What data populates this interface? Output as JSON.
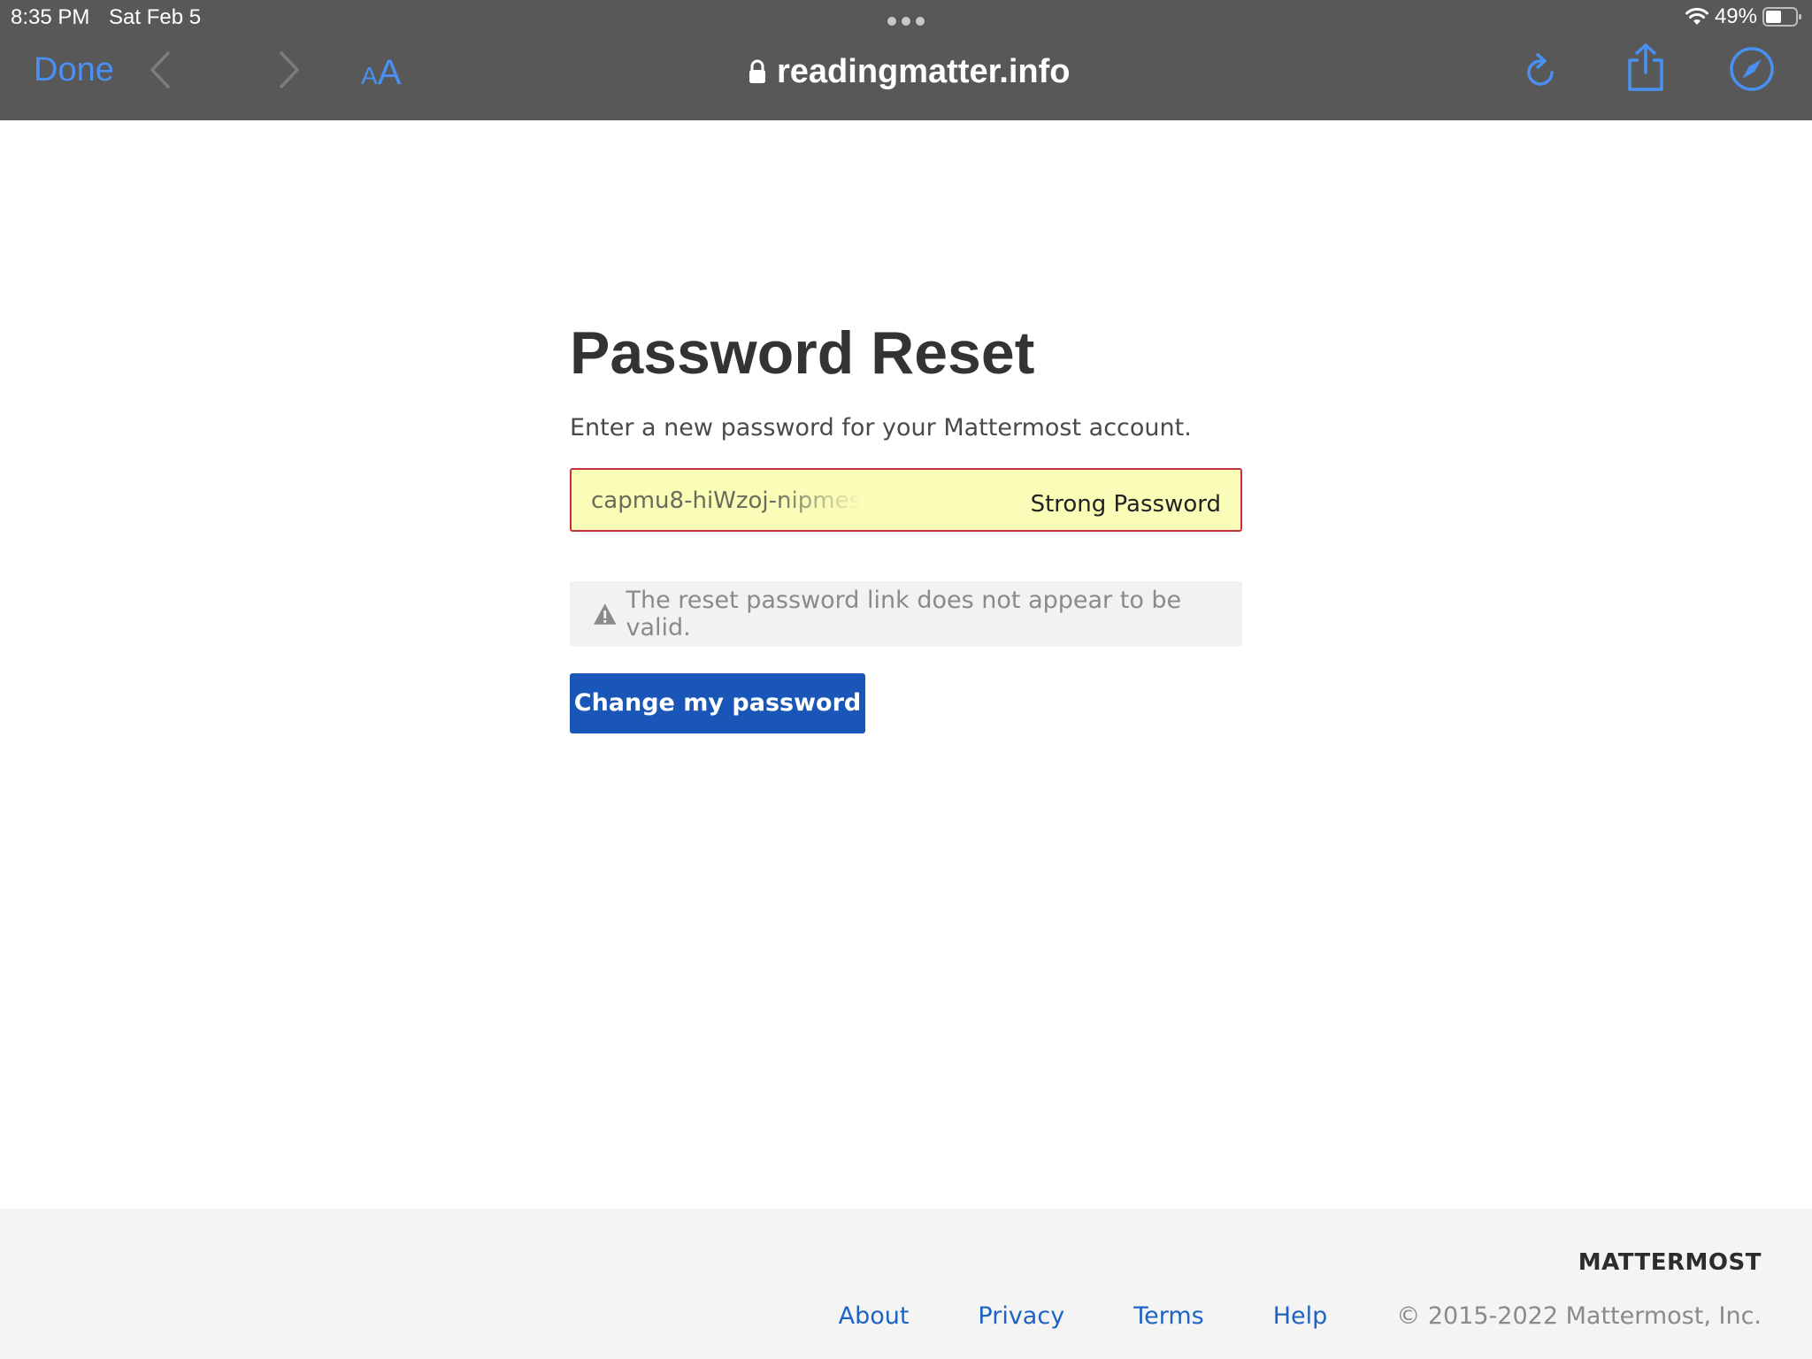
{
  "status_bar": {
    "time": "8:35 PM",
    "date": "Sat Feb 5",
    "battery": "49%",
    "icons": [
      "wifi-icon",
      "battery-icon"
    ]
  },
  "browser": {
    "done_label": "Done",
    "text_size_small": "A",
    "text_size_big": "A",
    "url": "readingmatter.info",
    "icons": [
      "back-chevron-icon",
      "forward-chevron-icon",
      "lock-icon",
      "reload-icon",
      "share-icon",
      "compass-icon"
    ],
    "accent_color": "#4a8ff2"
  },
  "main": {
    "title": "Password Reset",
    "description": "Enter a new password for your Mattermost account.",
    "password_value": "capmu8-hiWzoj-nipmes",
    "strong_password_label": "Strong Password",
    "alert_text": "The reset password link does not appear to be valid.",
    "alert_icon": "warning-icon",
    "submit_label": "Change my password",
    "button_color": "#1a56b8",
    "field_highlight_color": "#fafdb7",
    "field_error_border": "#c4323e"
  },
  "footer": {
    "brand": "MATTERMOST",
    "links": [
      {
        "label": "About"
      },
      {
        "label": "Privacy"
      },
      {
        "label": "Terms"
      },
      {
        "label": "Help"
      }
    ],
    "copyright": "© 2015-2022 Mattermost, Inc."
  }
}
